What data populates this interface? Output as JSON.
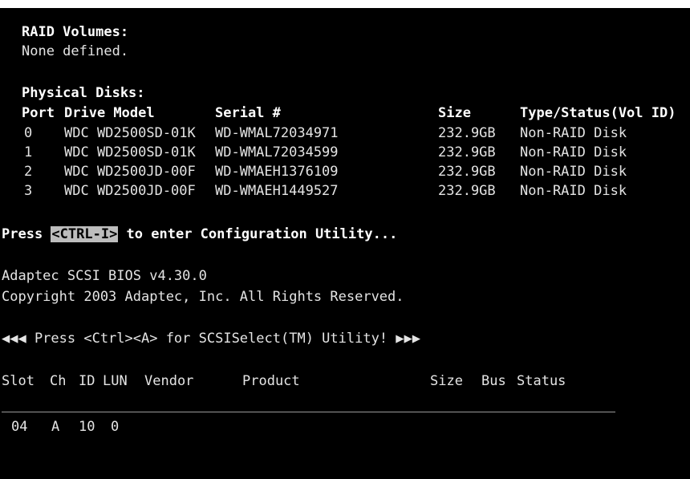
{
  "raid": {
    "heading": "RAID Volumes:",
    "none_text": "None defined."
  },
  "physical": {
    "heading": "Physical Disks:",
    "columns": {
      "port": "Port",
      "model": "Drive Model",
      "serial": "Serial #",
      "size": "Size",
      "type": "Type/Status(Vol ID)"
    },
    "disks": [
      {
        "port": "0",
        "model": "WDC WD2500SD-01K",
        "serial": "WD-WMAL72034971",
        "size": "232.9GB",
        "type": "Non-RAID Disk"
      },
      {
        "port": "1",
        "model": "WDC WD2500SD-01K",
        "serial": "WD-WMAL72034599",
        "size": "232.9GB",
        "type": "Non-RAID Disk"
      },
      {
        "port": "2",
        "model": "WDC WD2500JD-00F",
        "serial": "WD-WMAEH1376109",
        "size": "232.9GB",
        "type": "Non-RAID Disk"
      },
      {
        "port": "3",
        "model": "WDC WD2500JD-00F",
        "serial": "WD-WMAEH1449527",
        "size": "232.9GB",
        "type": "Non-RAID Disk"
      }
    ]
  },
  "prompt": {
    "prefix": "Press ",
    "key": "<CTRL-I>",
    "suffix": " to enter Configuration Utility..."
  },
  "bios": {
    "version_line": "Adaptec SCSI BIOS v4.30.0",
    "copyright_line": "Copyright 2003 Adaptec, Inc. All Rights Reserved.",
    "select_line": "◀◀◀ Press <Ctrl><A> for SCSISelect(TM) Utility! ▶▶▶"
  },
  "scsi": {
    "columns": {
      "slot": "Slot",
      "ch": "Ch",
      "id": "ID",
      "lun": "LUN",
      "vendor": "Vendor",
      "product": "Product",
      "size": "Size",
      "bus": "Bus",
      "status": "Status"
    },
    "row": {
      "slot": "04",
      "ch": "A",
      "id": "10",
      "lun": "0"
    }
  }
}
